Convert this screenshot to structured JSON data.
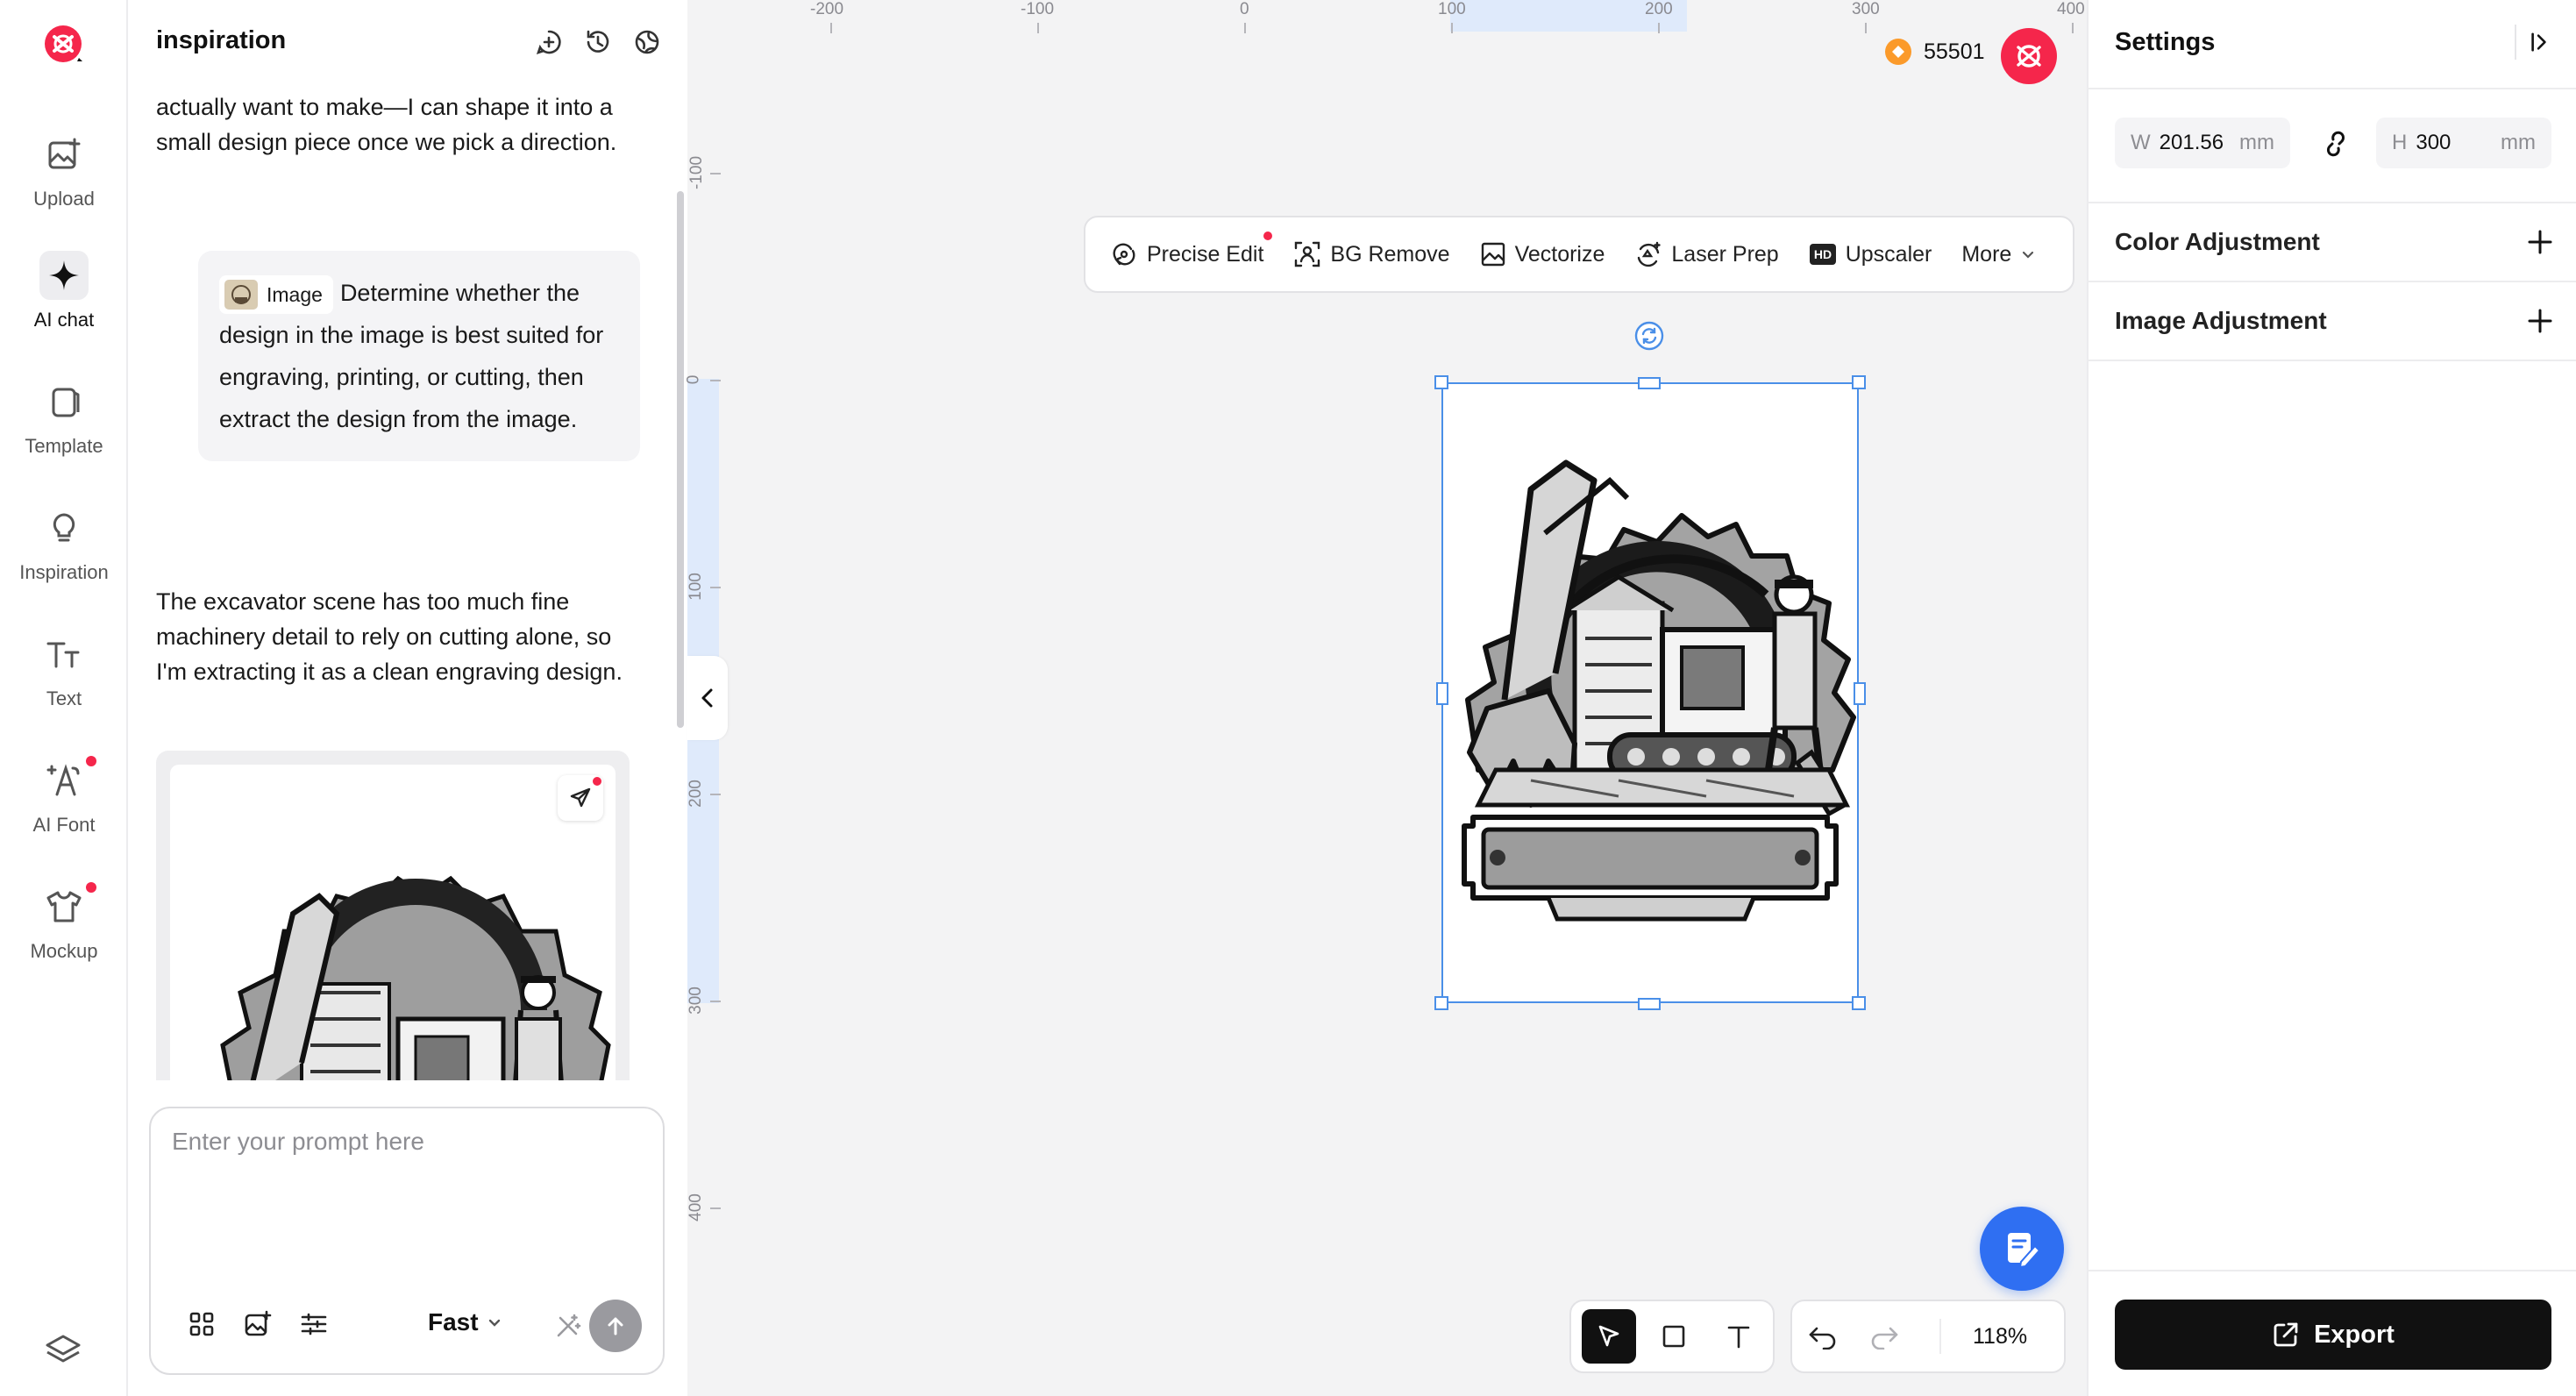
{
  "nav": {
    "items": [
      {
        "label": "Upload"
      },
      {
        "label": "AI chat"
      },
      {
        "label": "Template"
      },
      {
        "label": "Inspiration"
      },
      {
        "label": "Text"
      },
      {
        "label": "AI Font"
      },
      {
        "label": "Mockup"
      }
    ]
  },
  "chat": {
    "title": "inspiration",
    "messages": {
      "ai_1": "actually want to make—I can shape it into a small design piece once we pick a direction.",
      "user_chip": "Image",
      "user_text": "Determine whether the design in the image is best suited for engraving, printing, or cutting, then extract the design from the image.",
      "ai_2": "The excavator scene has too much fine machinery detail to rely on cutting alone, so I'm extracting it as a clean engraving design."
    },
    "prompt": {
      "placeholder": "Enter your prompt here",
      "value": "",
      "mode": "Fast"
    }
  },
  "canvas": {
    "ruler_top": [
      "-200",
      "-100",
      "0",
      "100",
      "200",
      "300",
      "400"
    ],
    "ruler_left": [
      "-100",
      "0",
      "100",
      "200",
      "300",
      "400"
    ],
    "credits": "55501",
    "toolbar": [
      {
        "label": "Precise Edit",
        "icon": "precise-edit-icon"
      },
      {
        "label": "BG Remove",
        "icon": "bg-remove-icon"
      },
      {
        "label": "Vectorize",
        "icon": "vectorize-icon"
      },
      {
        "label": "Laser Prep",
        "icon": "laser-prep-icon"
      },
      {
        "label": "Upscaler",
        "icon": "hd-icon"
      },
      {
        "label": "More",
        "icon": "chevron-down-icon"
      }
    ],
    "zoom": "118%"
  },
  "settings": {
    "title": "Settings",
    "width": {
      "key": "W",
      "value": "201.56",
      "unit": "mm"
    },
    "height": {
      "key": "H",
      "value": "300",
      "unit": "mm"
    },
    "sections": [
      "Color Adjustment",
      "Image Adjustment"
    ],
    "export": "Export"
  },
  "colors": {
    "brand": "#f5264b",
    "selection": "#4a8fe8",
    "fab": "#2f6ff2",
    "coin": "#fb9a2a"
  }
}
